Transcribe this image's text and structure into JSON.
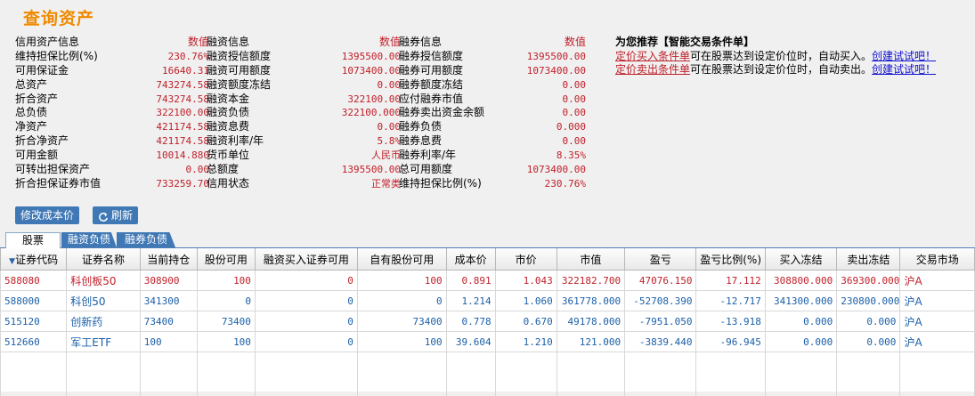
{
  "title": "查询资产",
  "credit": {
    "header": {
      "label": "信用资产信息",
      "value": "数值"
    },
    "rows": [
      {
        "label": "维持担保比例(%)",
        "value": "230.76%"
      },
      {
        "label": "可用保证金",
        "value": "16640.31"
      },
      {
        "label": "总资产",
        "value": "743274.58"
      },
      {
        "label": "折合资产",
        "value": "743274.58"
      },
      {
        "label": "总负债",
        "value": "322100.00"
      },
      {
        "label": "净资产",
        "value": "421174.58"
      },
      {
        "label": "折合净资产",
        "value": "421174.58"
      },
      {
        "label": "可用金额",
        "value": "10014.880"
      },
      {
        "label": "可转出担保资产",
        "value": "0.00"
      },
      {
        "label": "折合担保证券市值",
        "value": "733259.70"
      }
    ]
  },
  "financing": {
    "header": {
      "label": "融资信息",
      "value": "数值"
    },
    "rows": [
      {
        "label": "融资授信额度",
        "value": "1395500.00"
      },
      {
        "label": "融资可用额度",
        "value": "1073400.00"
      },
      {
        "label": "融资额度冻结",
        "value": "0.00"
      },
      {
        "label": "融资本金",
        "value": "322100.00"
      },
      {
        "label": "融资负债",
        "value": "322100.000"
      },
      {
        "label": "融资息费",
        "value": "0.00"
      },
      {
        "label": "融资利率/年",
        "value": "5.8%"
      },
      {
        "label": "货币单位",
        "value": "人民币"
      },
      {
        "label": "总额度",
        "value": "1395500.00"
      },
      {
        "label": "信用状态",
        "value": "正常类"
      }
    ]
  },
  "short": {
    "header": {
      "label": "融券信息",
      "value": "数值"
    },
    "rows": [
      {
        "label": "融券授信额度",
        "value": "1395500.00"
      },
      {
        "label": "融券可用额度",
        "value": "1073400.00"
      },
      {
        "label": "融券额度冻结",
        "value": "0.00"
      },
      {
        "label": "应付融券市值",
        "value": "0.00"
      },
      {
        "label": "融券卖出资金余额",
        "value": "0.00"
      },
      {
        "label": "融券负债",
        "value": "0.000"
      },
      {
        "label": "融券息费",
        "value": "0.00"
      },
      {
        "label": "融券利率/年",
        "value": "8.35%"
      },
      {
        "label": "总可用额度",
        "value": "1073400.00"
      },
      {
        "label": "维持担保比例(%)",
        "value": "230.76%"
      }
    ]
  },
  "recommend": {
    "title": "为您推荐【智能交易条件单】",
    "lines": [
      {
        "link": "定价买入条件单",
        "text": "可在股票达到设定价位时，自动买入。",
        "action": "创建试试吧！"
      },
      {
        "link": "定价卖出条件单",
        "text": "可在股票达到设定价位时，自动卖出。",
        "action": "创建试试吧！"
      }
    ]
  },
  "buttons": {
    "edit_cost": "修改成本价",
    "refresh": "刷新"
  },
  "tabs": [
    "股票",
    "融资负债",
    "融券负债"
  ],
  "table": {
    "sort_marker": "▼",
    "columns": [
      "证券代码",
      "证券名称",
      "当前持仓",
      "股份可用",
      "融资买入证券可用",
      "自有股份可用",
      "成本价",
      "市价",
      "市值",
      "盈亏",
      "盈亏比例(%)",
      "买入冻结",
      "卖出冻结",
      "交易市场"
    ],
    "rows": [
      {
        "trend": "pos",
        "cells": [
          "588080",
          "科创板50",
          "308900",
          "100",
          "0",
          "100",
          "0.891",
          "1.043",
          "322182.700",
          "47076.150",
          "17.112",
          "308800.000",
          "369300.000",
          "沪A"
        ]
      },
      {
        "trend": "neg",
        "cells": [
          "588000",
          "科创50",
          "341300",
          "0",
          "0",
          "0",
          "1.214",
          "1.060",
          "361778.000",
          "-52708.390",
          "-12.717",
          "341300.000",
          "230800.000",
          "沪A"
        ]
      },
      {
        "trend": "neg",
        "cells": [
          "515120",
          "创新药",
          "73400",
          "73400",
          "0",
          "73400",
          "0.778",
          "0.670",
          "49178.000",
          "-7951.050",
          "-13.918",
          "0.000",
          "0.000",
          "沪A"
        ]
      },
      {
        "trend": "neg",
        "cells": [
          "512660",
          "军工ETF",
          "100",
          "100",
          "0",
          "100",
          "39.604",
          "1.210",
          "121.000",
          "-3839.440",
          "-96.945",
          "0.000",
          "0.000",
          "沪A"
        ]
      }
    ]
  },
  "colors": {
    "accent": "#f08a00",
    "positive": "#c0202a",
    "negative": "#1a5fa8",
    "button": "#3f78b5"
  }
}
